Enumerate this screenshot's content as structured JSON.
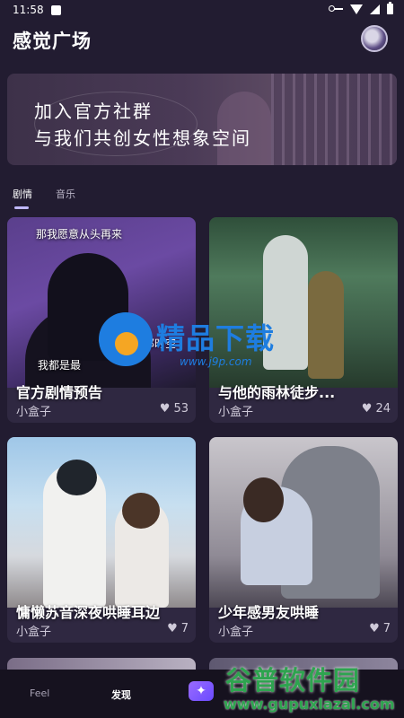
{
  "status": {
    "time": "11:58"
  },
  "header": {
    "title": "感觉广场"
  },
  "banner": {
    "line1": "加入官方社群",
    "line2": "与我们共创女性想象空间"
  },
  "tabs": [
    {
      "label": "剧情",
      "active": true
    },
    {
      "label": "音乐",
      "active": false
    }
  ],
  "cards": [
    {
      "title": "官方剧情预告",
      "author": "小盒子",
      "likes": "53",
      "overlay_lines": [
        "那我愿意从头再来",
        "我都是最",
        "在你那时空"
      ]
    },
    {
      "title": "与他的雨林徒步...",
      "author": "小盒子",
      "likes": "24"
    },
    {
      "title": "慵懒苏音深夜哄睡耳边",
      "author": "小盒子",
      "likes": "7"
    },
    {
      "title": "少年感男友哄睡",
      "author": "小盒子",
      "likes": "7"
    }
  ],
  "bottom_nav": {
    "feel": "Feel",
    "discover": "发现"
  },
  "watermarks": {
    "jingpin": {
      "text": "精品下载",
      "url": "www.j9p.com"
    },
    "gupu": {
      "text": "谷普软件园",
      "url": "www.gupuxlazal.com"
    }
  },
  "colors": {
    "background": "#221c31",
    "accent": "#c0b8ff",
    "nav_bg": "#16121f"
  }
}
